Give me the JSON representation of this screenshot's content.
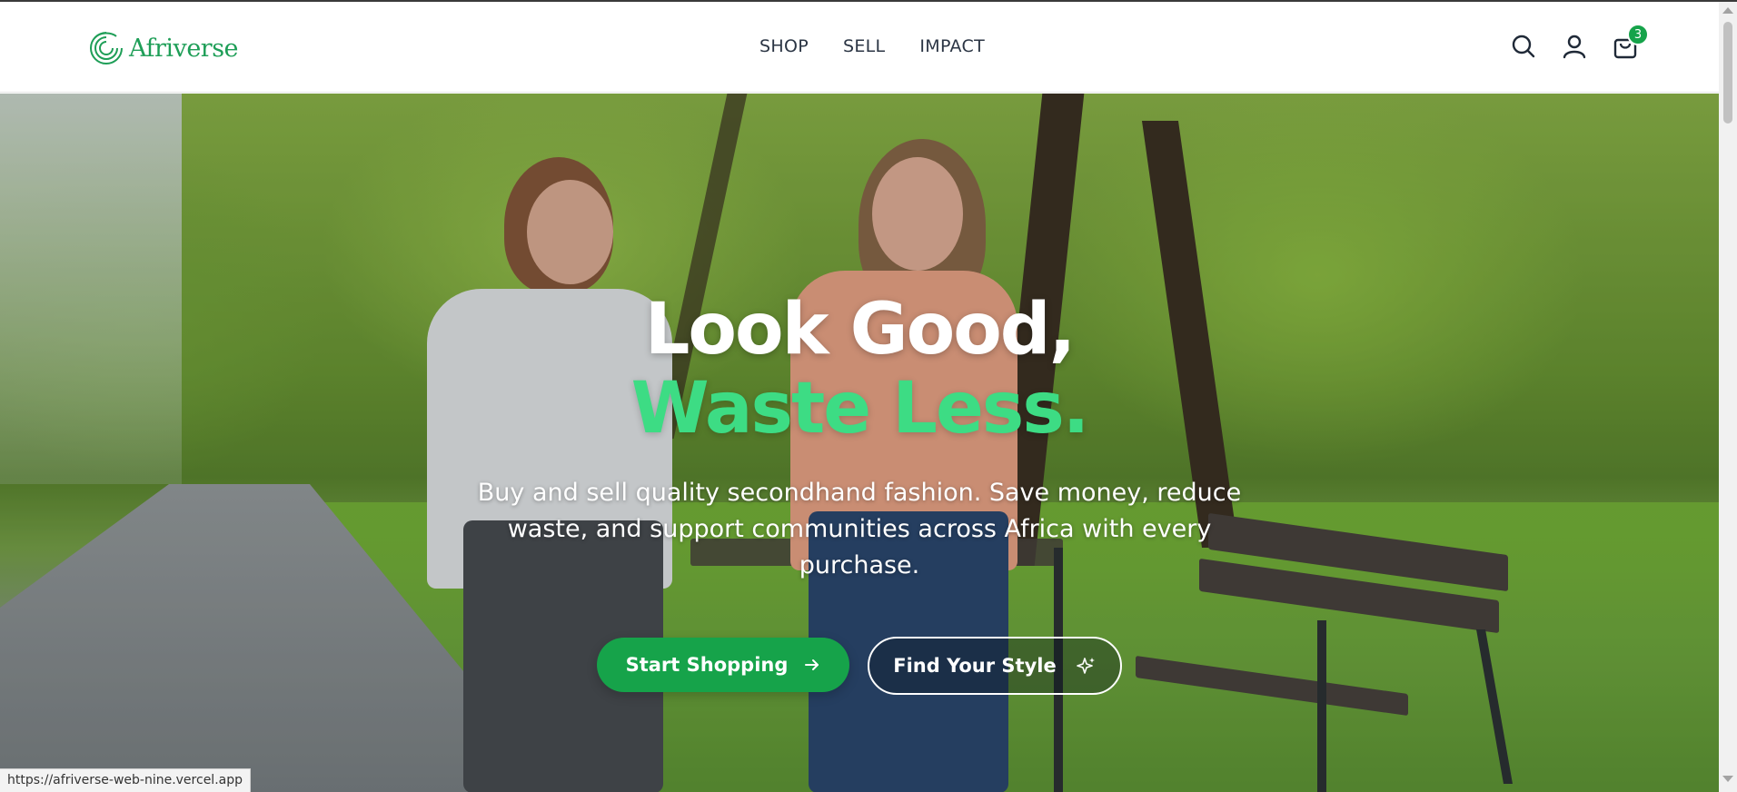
{
  "brand": {
    "name": "Afriverse",
    "accent": "#1e9e57"
  },
  "nav": {
    "items": [
      "SHOP",
      "SELL",
      "IMPACT"
    ]
  },
  "header_icons": {
    "search": "search-icon",
    "account": "user-icon",
    "cart": "shopping-bag-icon",
    "cart_count": "3"
  },
  "hero": {
    "title_line1": "Look Good,",
    "title_line2": "Waste Less.",
    "title_line2_color": "#3ddc84",
    "subtitle": "Buy and sell quality secondhand fashion. Save money, reduce waste, and support communities across Africa with every purchase.",
    "primary_button": {
      "label": "Start Shopping",
      "icon": "arrow-right-icon",
      "color": "#16a34a"
    },
    "secondary_button": {
      "label": "Find Your Style",
      "icon": "sparkles-icon"
    }
  },
  "status_bar": {
    "url": "https://afriverse-web-nine.vercel.app"
  }
}
